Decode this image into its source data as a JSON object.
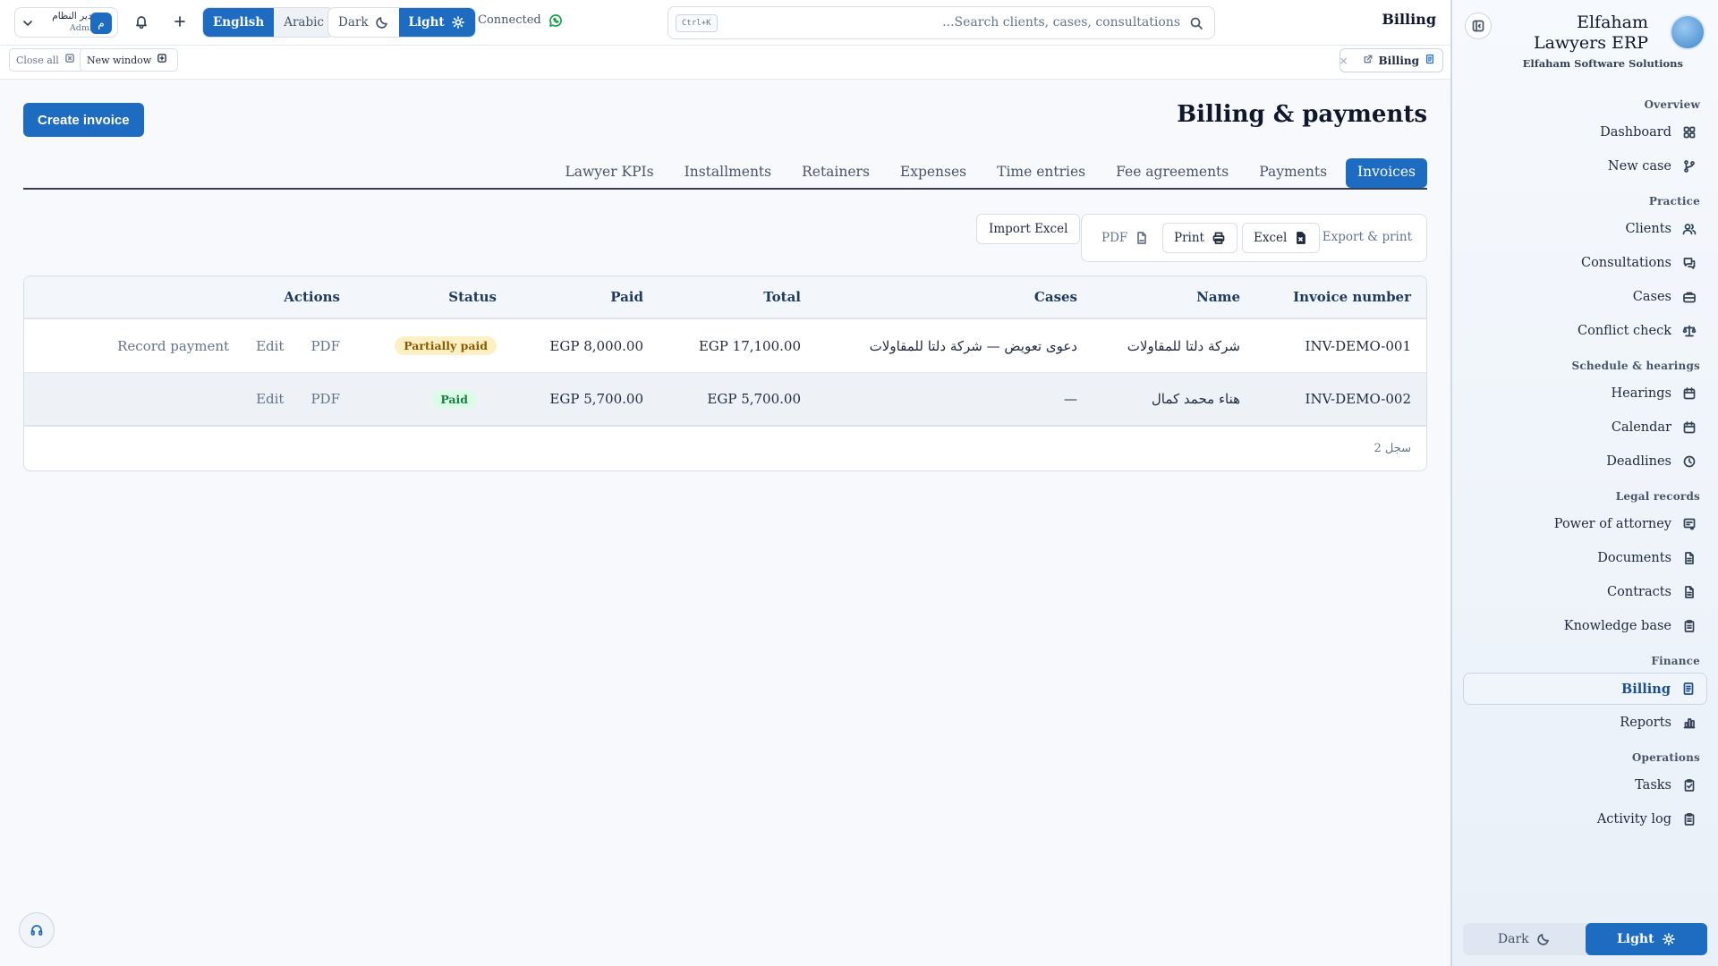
{
  "topbar": {
    "user": {
      "name": "مدير النظام",
      "role": "Admin",
      "initial": "م"
    },
    "language": {
      "options": [
        "English",
        "Arabic"
      ],
      "selected": "English"
    },
    "theme": {
      "dark": "Dark",
      "light": "Light",
      "selected": "Light"
    },
    "status": "Connected",
    "search": {
      "shortcut": "Ctrl+K",
      "placeholder": "...Search clients, cases, consultations"
    },
    "page_label": "Billing"
  },
  "tabstrip": {
    "close_all": "Close all",
    "new_window": "New window",
    "open_tab": "Billing"
  },
  "main": {
    "create_label": "Create invoice",
    "title": "Billing & payments",
    "tabs": [
      "Lawyer KPIs",
      "Installments",
      "Retainers",
      "Expenses",
      "Time entries",
      "Fee agreements",
      "Payments",
      "Invoices"
    ],
    "active_tab": "Invoices",
    "import_label": "Import Excel",
    "export": {
      "pdf": "PDF",
      "print": "Print",
      "excel": "Excel",
      "label": "Export & print"
    }
  },
  "table": {
    "headers": {
      "invoice": "Invoice number",
      "name": "Name",
      "cases": "Cases",
      "total": "Total",
      "paid": "Paid",
      "status": "Status",
      "actions": "Actions"
    },
    "rows": [
      {
        "invoice": "INV-DEMO-001",
        "name": "شركة دلتا للمقاولات",
        "cases": "دعوى تعويض — شركة دلتا للمقاولات",
        "total": "EGP 17,100.00",
        "paid": "EGP 8,000.00",
        "status": "Partially paid",
        "actions": [
          "PDF",
          "Edit",
          "Record payment"
        ]
      },
      {
        "invoice": "INV-DEMO-002",
        "name": "هناء محمد كمال",
        "cases": "—",
        "total": "EGP 5,700.00",
        "paid": "EGP 5,700.00",
        "status": "Paid",
        "actions": [
          "PDF",
          "Edit"
        ]
      }
    ],
    "footer": "2 سجل"
  },
  "sidebar": {
    "brand": {
      "name": "Elfaham Lawyers ERP",
      "subtitle": "Elfaham Software Solutions"
    },
    "groups": [
      {
        "title": "Overview",
        "items": [
          {
            "label": "Dashboard",
            "icon": "dashboard-icon"
          },
          {
            "label": "New case",
            "icon": "git-branch-icon"
          }
        ]
      },
      {
        "title": "Practice",
        "items": [
          {
            "label": "Clients",
            "icon": "users-icon"
          },
          {
            "label": "Consultations",
            "icon": "chat-icon"
          },
          {
            "label": "Cases",
            "icon": "briefcase-icon"
          },
          {
            "label": "Conflict check",
            "icon": "scale-icon"
          }
        ]
      },
      {
        "title": "Schedule & hearings",
        "items": [
          {
            "label": "Hearings",
            "icon": "calendar-icon"
          },
          {
            "label": "Calendar",
            "icon": "calendar-icon"
          },
          {
            "label": "Deadlines",
            "icon": "clock-icon"
          }
        ]
      },
      {
        "title": "Legal records",
        "items": [
          {
            "label": "Power of attorney",
            "icon": "stamp-icon"
          },
          {
            "label": "Documents",
            "icon": "file-icon"
          },
          {
            "label": "Contracts",
            "icon": "file-icon"
          },
          {
            "label": "Knowledge base",
            "icon": "clipboard-icon"
          }
        ]
      },
      {
        "title": "Finance",
        "items": [
          {
            "label": "Billing",
            "icon": "receipt-icon"
          },
          {
            "label": "Reports",
            "icon": "bar-chart-icon"
          }
        ]
      },
      {
        "title": "Operations",
        "items": [
          {
            "label": "Tasks",
            "icon": "checklist-icon"
          },
          {
            "label": "Activity log",
            "icon": "clipboard-icon"
          }
        ]
      }
    ],
    "active": "Billing",
    "theme": {
      "dark": "Dark",
      "light": "Light",
      "selected": "Light"
    }
  },
  "colors": {
    "accent": "#1e6cc1",
    "partial_bg": "#fdf0c4",
    "paid_bg": "#dcfce7",
    "connected": "#16a34a"
  }
}
